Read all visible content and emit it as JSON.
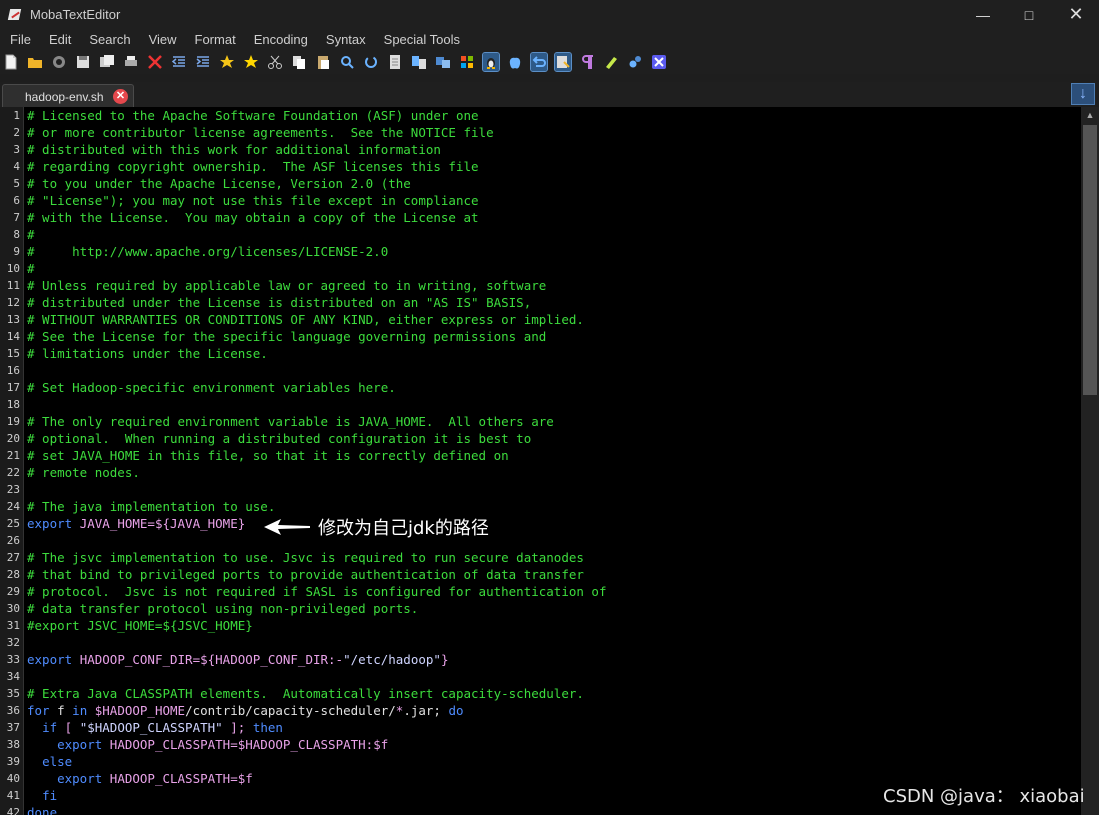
{
  "window": {
    "title": "MobaTextEditor",
    "controls": [
      "minimize-icon",
      "maximize-icon",
      "close-icon"
    ]
  },
  "menu": [
    "File",
    "Edit",
    "Search",
    "View",
    "Format",
    "Encoding",
    "Syntax",
    "Special Tools"
  ],
  "toolbar": {
    "icons": [
      "new-file-icon",
      "open-folder-icon",
      "reload-icon",
      "save-icon",
      "save-all-icon",
      "print-icon",
      "close-file-icon",
      "outdent-icon",
      "indent-icon",
      "bookmark-star-icon",
      "favorite-star-icon",
      "cut-icon",
      "copy-icon",
      "paste-icon",
      "find-icon",
      "replace-icon",
      "document-icon",
      "compare-icon",
      "compare-alt-icon",
      "windows-mode-icon",
      "linux-mode-icon",
      "mac-mode-icon",
      "undo-icon",
      "save-as-icon",
      "paragraph-icon",
      "highlight-icon",
      "settings-icon",
      "exit-icon"
    ],
    "selected": [
      "linux-mode-icon",
      "undo-icon",
      "save-as-icon"
    ]
  },
  "tab": {
    "label": "hadoop-env.sh"
  },
  "editor": {
    "lines": [
      {
        "n": "1",
        "t": [
          {
            "c": "c",
            "s": "# Licensed to the Apache Software Foundation (ASF) under one"
          }
        ]
      },
      {
        "n": "2",
        "t": [
          {
            "c": "c",
            "s": "# or more contributor license agreements.  See the NOTICE file"
          }
        ]
      },
      {
        "n": "3",
        "t": [
          {
            "c": "c",
            "s": "# distributed with this work for additional information"
          }
        ]
      },
      {
        "n": "4",
        "t": [
          {
            "c": "c",
            "s": "# regarding copyright ownership.  The ASF licenses this file"
          }
        ]
      },
      {
        "n": "5",
        "t": [
          {
            "c": "c",
            "s": "# to you under the Apache License, Version 2.0 (the"
          }
        ]
      },
      {
        "n": "6",
        "t": [
          {
            "c": "c",
            "s": "# \"License\"); you may not use this file except in compliance"
          }
        ]
      },
      {
        "n": "7",
        "t": [
          {
            "c": "c",
            "s": "# with the License.  You may obtain a copy of the License at"
          }
        ]
      },
      {
        "n": "8",
        "t": [
          {
            "c": "c",
            "s": "#"
          }
        ]
      },
      {
        "n": "9",
        "t": [
          {
            "c": "c",
            "s": "#     http://www.apache.org/licenses/LICENSE-2.0"
          }
        ]
      },
      {
        "n": "10",
        "t": [
          {
            "c": "c",
            "s": "#"
          }
        ]
      },
      {
        "n": "11",
        "t": [
          {
            "c": "c",
            "s": "# Unless required by applicable law or agreed to in writing, software"
          }
        ]
      },
      {
        "n": "12",
        "t": [
          {
            "c": "c",
            "s": "# distributed under the License is distributed on an \"AS IS\" BASIS,"
          }
        ]
      },
      {
        "n": "13",
        "t": [
          {
            "c": "c",
            "s": "# WITHOUT WARRANTIES OR CONDITIONS OF ANY KIND, either express or implied."
          }
        ]
      },
      {
        "n": "14",
        "t": [
          {
            "c": "c",
            "s": "# See the License for the specific language governing permissions and"
          }
        ]
      },
      {
        "n": "15",
        "t": [
          {
            "c": "c",
            "s": "# limitations under the License."
          }
        ]
      },
      {
        "n": "16",
        "t": []
      },
      {
        "n": "17",
        "t": [
          {
            "c": "c",
            "s": "# Set Hadoop-specific environment variables here."
          }
        ]
      },
      {
        "n": "18",
        "t": []
      },
      {
        "n": "19",
        "t": [
          {
            "c": "c",
            "s": "# The only required environment variable is JAVA_HOME.  All others are"
          }
        ]
      },
      {
        "n": "20",
        "t": [
          {
            "c": "c",
            "s": "# optional.  When running a distributed configuration it is best to"
          }
        ]
      },
      {
        "n": "21",
        "t": [
          {
            "c": "c",
            "s": "# set JAVA_HOME in this file, so that it is correctly defined on"
          }
        ]
      },
      {
        "n": "22",
        "t": [
          {
            "c": "c",
            "s": "# remote nodes."
          }
        ]
      },
      {
        "n": "23",
        "t": []
      },
      {
        "n": "24",
        "t": [
          {
            "c": "c",
            "s": "# The java implementation to use."
          }
        ]
      },
      {
        "n": "25",
        "t": [
          {
            "c": "k",
            "s": "export "
          },
          {
            "c": "v",
            "s": "JAVA_HOME=${JAVA_HOME}"
          }
        ]
      },
      {
        "n": "26",
        "t": []
      },
      {
        "n": "27",
        "t": [
          {
            "c": "c",
            "s": "# The jsvc implementation to use. Jsvc is required to run secure datanodes"
          }
        ]
      },
      {
        "n": "28",
        "t": [
          {
            "c": "c",
            "s": "# that bind to privileged ports to provide authentication of data transfer"
          }
        ]
      },
      {
        "n": "29",
        "t": [
          {
            "c": "c",
            "s": "# protocol.  Jsvc is not required if SASL is configured for authentication of"
          }
        ]
      },
      {
        "n": "30",
        "t": [
          {
            "c": "c",
            "s": "# data transfer protocol using non-privileged ports."
          }
        ]
      },
      {
        "n": "31",
        "t": [
          {
            "c": "c",
            "s": "#export JSVC_HOME=${JSVC_HOME}"
          }
        ]
      },
      {
        "n": "32",
        "t": []
      },
      {
        "n": "33",
        "t": [
          {
            "c": "k",
            "s": "export "
          },
          {
            "c": "v",
            "s": "HADOOP_CONF_DIR=${HADOOP_CONF_DIR:-"
          },
          {
            "c": "s",
            "s": "\"/etc/hadoop\""
          },
          {
            "c": "v",
            "s": "}"
          }
        ]
      },
      {
        "n": "34",
        "t": []
      },
      {
        "n": "35",
        "t": [
          {
            "c": "c",
            "s": "# Extra Java CLASSPATH elements.  Automatically insert capacity-scheduler."
          }
        ]
      },
      {
        "n": "36",
        "t": [
          {
            "c": "k",
            "s": "for "
          },
          {
            "c": "p",
            "s": "f "
          },
          {
            "c": "k",
            "s": "in "
          },
          {
            "c": "v",
            "s": "$HADOOP_HOME"
          },
          {
            "c": "p",
            "s": "/contrib/capacity-scheduler/"
          },
          {
            "c": "v",
            "s": "*"
          },
          {
            "c": "p",
            "s": ".jar; "
          },
          {
            "c": "k",
            "s": "do"
          }
        ]
      },
      {
        "n": "37",
        "t": [
          {
            "c": "p",
            "s": "  "
          },
          {
            "c": "k",
            "s": "if "
          },
          {
            "c": "v",
            "s": "[ "
          },
          {
            "c": "s",
            "s": "\"$HADOOP_CLASSPATH\""
          },
          {
            "c": "v",
            "s": " ]; "
          },
          {
            "c": "k",
            "s": "then"
          }
        ]
      },
      {
        "n": "38",
        "t": [
          {
            "c": "p",
            "s": "    "
          },
          {
            "c": "k",
            "s": "export "
          },
          {
            "c": "v",
            "s": "HADOOP_CLASSPATH=$HADOOP_CLASSPATH:$f"
          }
        ]
      },
      {
        "n": "39",
        "t": [
          {
            "c": "p",
            "s": "  "
          },
          {
            "c": "k",
            "s": "else"
          }
        ]
      },
      {
        "n": "40",
        "t": [
          {
            "c": "p",
            "s": "    "
          },
          {
            "c": "k",
            "s": "export "
          },
          {
            "c": "v",
            "s": "HADOOP_CLASSPATH=$f"
          }
        ]
      },
      {
        "n": "41",
        "t": [
          {
            "c": "p",
            "s": "  "
          },
          {
            "c": "k",
            "s": "fi"
          }
        ]
      },
      {
        "n": "42",
        "t": [
          {
            "c": "k",
            "s": "done"
          }
        ]
      }
    ]
  },
  "annotation": {
    "text": "修改为自己jdk的路径"
  },
  "watermark": "CSDN @java： xiaobai",
  "colors": {
    "comment": "#3ddc3d",
    "keyword": "#4f8cff",
    "variable": "#e8a2e8",
    "string": "#cfd4ff",
    "background": "#000000"
  }
}
